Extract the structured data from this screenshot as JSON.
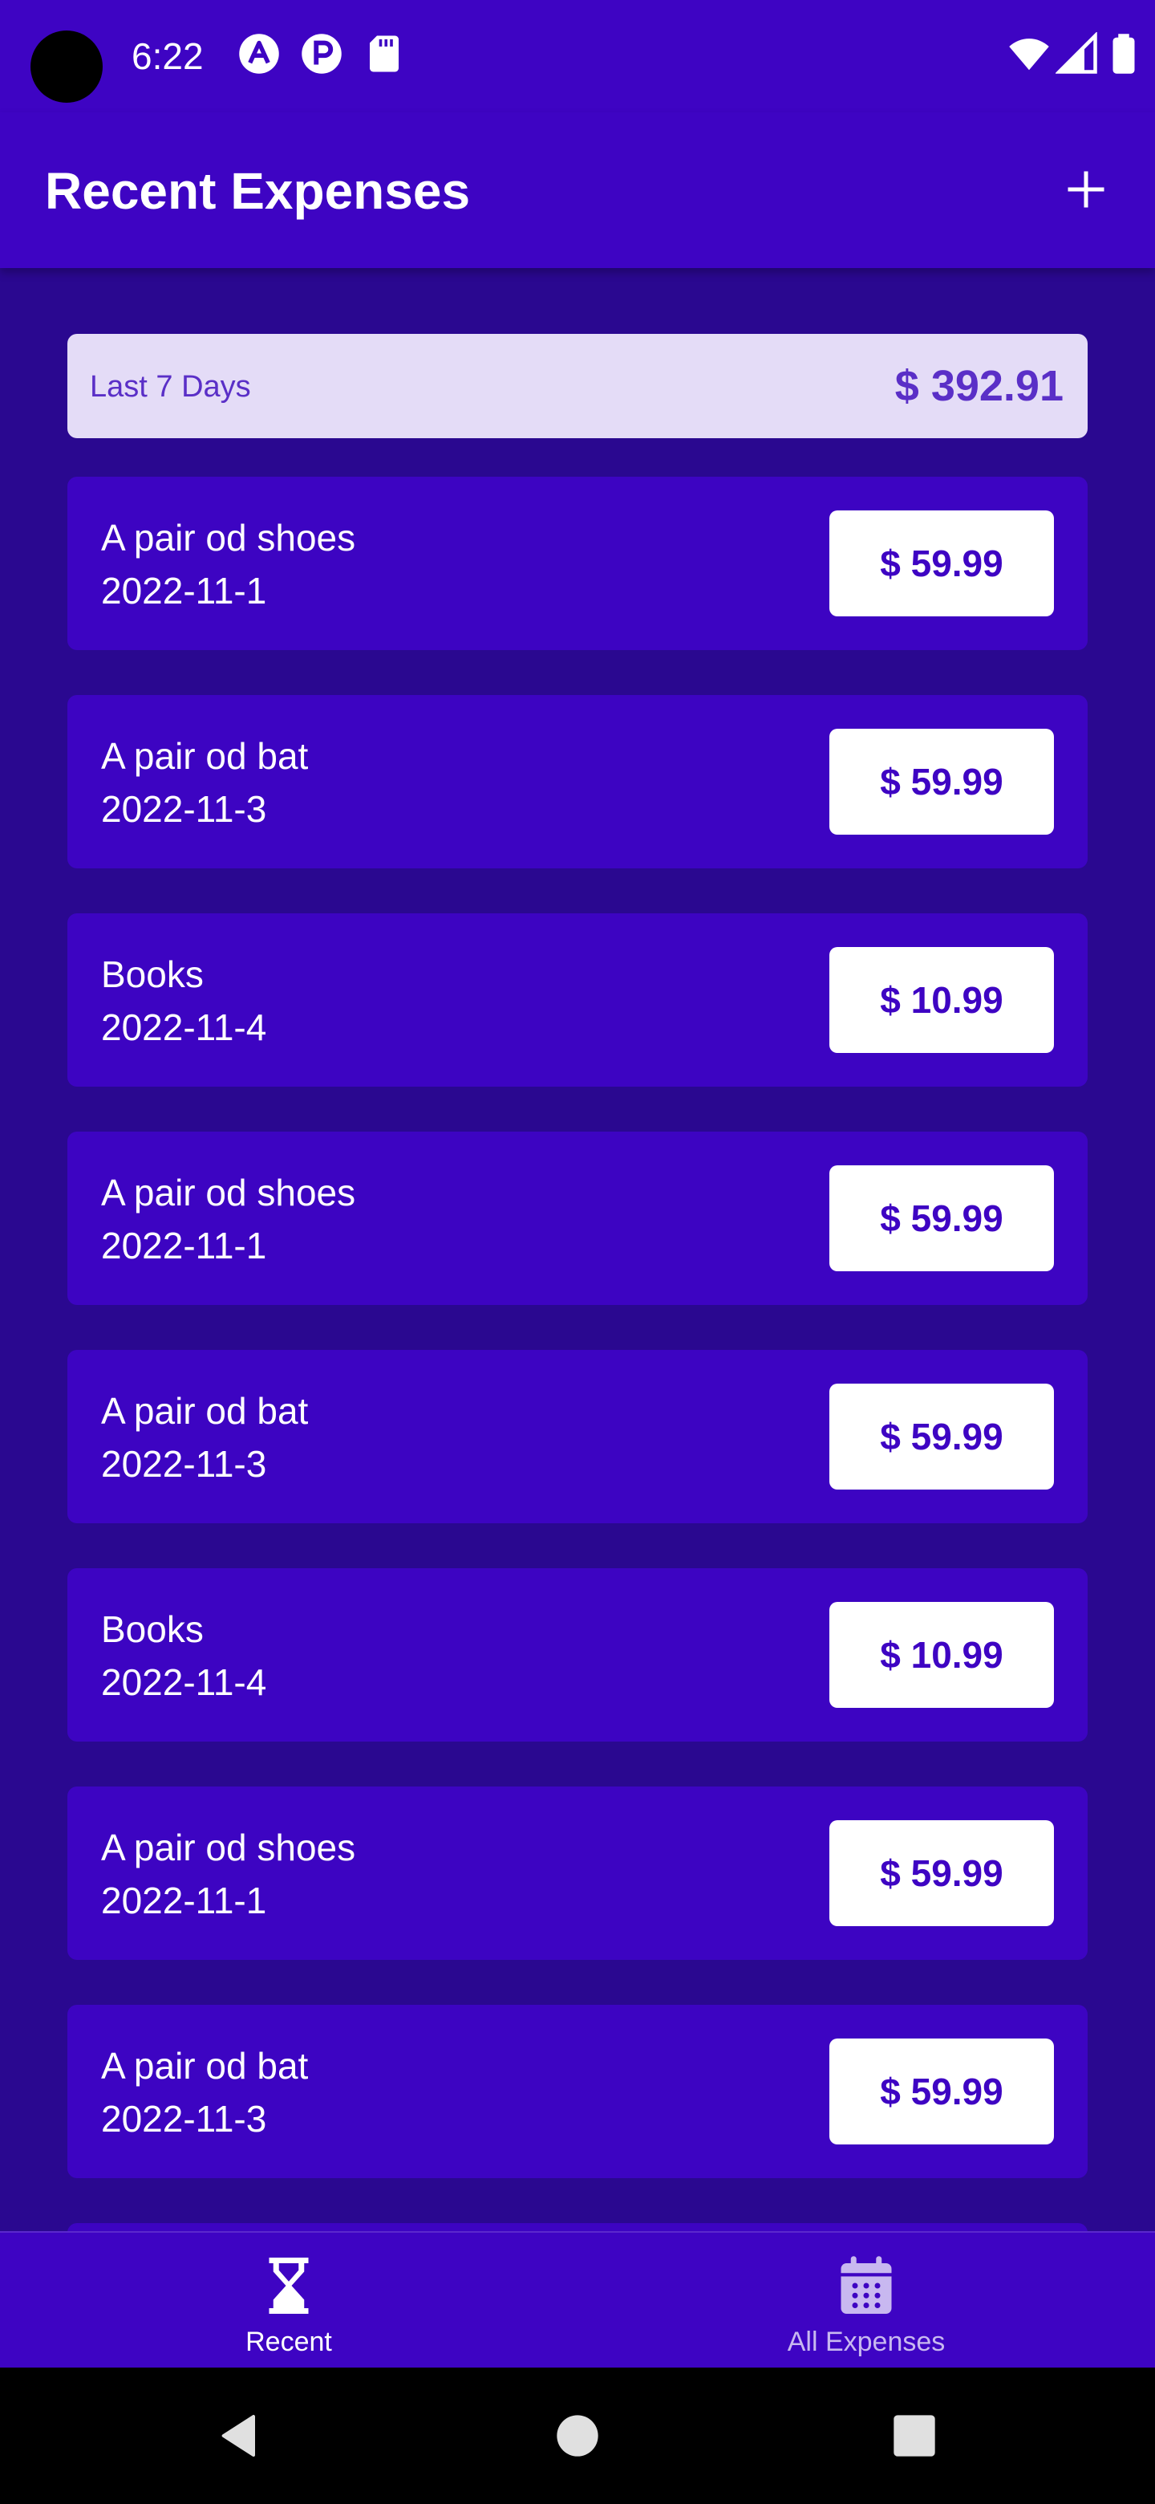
{
  "status_bar": {
    "time": "6:22"
  },
  "app_bar": {
    "title": "Recent Expenses",
    "add_icon": "plus-icon"
  },
  "summary": {
    "label": "Last 7 Days",
    "total": "$ 392.91"
  },
  "expenses": [
    {
      "description": "A pair od shoes",
      "date": "2022-11-1",
      "amount": "$ 59.99"
    },
    {
      "description": "A pair od bat",
      "date": "2022-11-3",
      "amount": "$ 59.99"
    },
    {
      "description": "Books",
      "date": "2022-11-4",
      "amount": "$ 10.99"
    },
    {
      "description": "A pair od shoes",
      "date": "2022-11-1",
      "amount": "$ 59.99"
    },
    {
      "description": "A pair od bat",
      "date": "2022-11-3",
      "amount": "$ 59.99"
    },
    {
      "description": "Books",
      "date": "2022-11-4",
      "amount": "$ 10.99"
    },
    {
      "description": "A pair od shoes",
      "date": "2022-11-1",
      "amount": "$ 59.99"
    },
    {
      "description": "A pair od bat",
      "date": "2022-11-3",
      "amount": "$ 59.99"
    },
    {
      "description": "",
      "date": "",
      "amount": ""
    }
  ],
  "bottom_nav": {
    "tabs": [
      {
        "label": "Recent",
        "icon": "hourglass-icon",
        "active": true
      },
      {
        "label": "All Expenses",
        "icon": "calendar-icon",
        "active": false
      }
    ]
  },
  "colors": {
    "primary": "#3e04c3",
    "background": "#2a0890",
    "summary_bg": "#e4dcf7",
    "accent_text": "#5a2fc7",
    "inactive_tab": "#c8b8f0"
  }
}
